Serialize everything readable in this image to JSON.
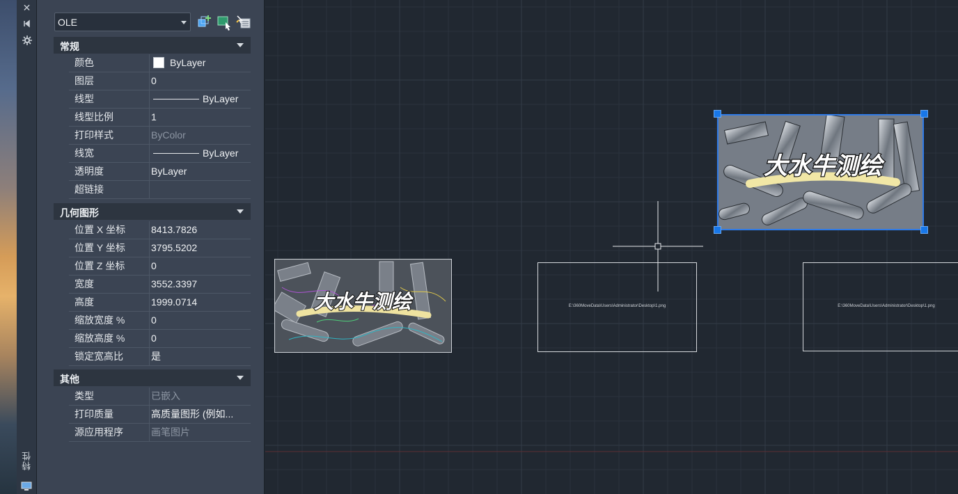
{
  "palette": {
    "title": "特性",
    "icons": [
      "close-icon",
      "auto-hide-icon",
      "settings-icon"
    ]
  },
  "properties": {
    "object_type": "OLE",
    "toolbar_icons": [
      "toggle-pickadd-icon",
      "select-objects-icon",
      "quick-select-icon"
    ],
    "sections": {
      "general": {
        "title": "常规",
        "rows": [
          {
            "name": "颜色",
            "value": "ByLayer"
          },
          {
            "name": "图层",
            "value": "0"
          },
          {
            "name": "线型",
            "value": "ByLayer"
          },
          {
            "name": "线型比例",
            "value": "1"
          },
          {
            "name": "打印样式",
            "value": "ByColor"
          },
          {
            "name": "线宽",
            "value": "ByLayer"
          },
          {
            "name": "透明度",
            "value": "ByLayer"
          },
          {
            "name": "超链接",
            "value": ""
          }
        ]
      },
      "geometry": {
        "title": "几何图形",
        "rows": [
          {
            "name": "位置 X 坐标",
            "value": "8413.7826"
          },
          {
            "name": "位置 Y 坐标",
            "value": "3795.5202"
          },
          {
            "name": "位置 Z 坐标",
            "value": "0"
          },
          {
            "name": "宽度",
            "value": "3552.3397"
          },
          {
            "name": "高度",
            "value": "1999.0714"
          },
          {
            "name": "缩放宽度 %",
            "value": "0"
          },
          {
            "name": "缩放高度 %",
            "value": "0"
          },
          {
            "name": "锁定宽高比",
            "value": "是"
          }
        ]
      },
      "misc": {
        "title": "其他",
        "rows": [
          {
            "name": "类型",
            "value": "已嵌入"
          },
          {
            "name": "打印质量",
            "value": "高质量图形 (例如..."
          },
          {
            "name": "源应用程序",
            "value": "画笔图片"
          }
        ]
      }
    }
  },
  "canvas": {
    "image_caption": "大水牛测绘",
    "ole_path": "E:\\360MoveData\\Users\\Administrator\\Desktop\\1.png"
  }
}
